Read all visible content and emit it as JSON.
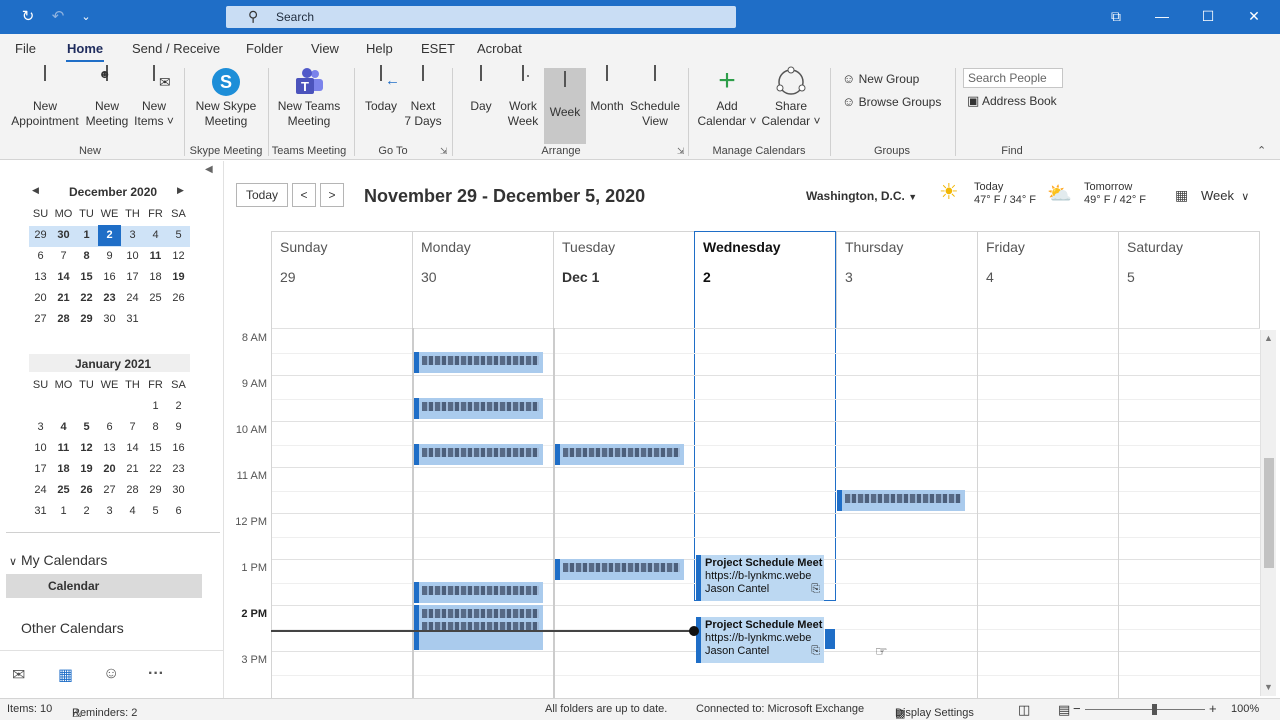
{
  "titlebar": {
    "search_placeholder": "Search",
    "refresh_icon": "↻",
    "undo_icon": "↶",
    "customize_icon": "⌄",
    "ribbon_display_icon": "⧉",
    "minimize_icon": "—",
    "maximize_icon": "☐",
    "close_icon": "✕"
  },
  "menu": {
    "tabs": [
      "File",
      "Home",
      "Send / Receive",
      "Folder",
      "View",
      "Help",
      "ESET",
      "Acrobat"
    ],
    "active": "Home"
  },
  "ribbon": {
    "new_appointment": [
      "New",
      "Appointment"
    ],
    "new_meeting": [
      "New",
      "Meeting"
    ],
    "new_items": [
      "New",
      "Items ˅"
    ],
    "group_new": "New",
    "new_skype_meeting": [
      "New Skype",
      "Meeting"
    ],
    "group_skype": "Skype Meeting",
    "new_teams_meeting": [
      "New Teams",
      "Meeting"
    ],
    "group_teams": "Teams Meeting",
    "today": [
      "Today",
      ""
    ],
    "next7": [
      "Next",
      "7 Days"
    ],
    "group_goto": "Go To",
    "day": "Day",
    "work_week": [
      "Work",
      "Week"
    ],
    "week": "Week",
    "month": "Month",
    "schedule_view": [
      "Schedule",
      "View"
    ],
    "group_arrange": "Arrange",
    "add_calendar": [
      "Add",
      "Calendar ˅"
    ],
    "share_calendar": [
      "Share",
      "Calendar ˅"
    ],
    "group_manage": "Manage Calendars",
    "new_group": "New Group",
    "browse_groups": "Browse Groups",
    "group_groups": "Groups",
    "search_people_placeholder": "Search People",
    "address_book": "Address Book",
    "group_find": "Find"
  },
  "minical": {
    "dec_title": "December 2020",
    "jan_title": "January 2021",
    "weekdays": [
      "SU",
      "MO",
      "TU",
      "WE",
      "TH",
      "FR",
      "SA"
    ],
    "dec_rows": [
      [
        "29",
        "30",
        "1",
        "2",
        "3",
        "4",
        "5"
      ],
      [
        "6",
        "7",
        "8",
        "9",
        "10",
        "11",
        "12"
      ],
      [
        "13",
        "14",
        "15",
        "16",
        "17",
        "18",
        "19"
      ],
      [
        "20",
        "21",
        "22",
        "23",
        "24",
        "25",
        "26"
      ],
      [
        "27",
        "28",
        "29",
        "30",
        "31",
        "",
        ""
      ]
    ],
    "jan_rows": [
      [
        "",
        "",
        "",
        "",
        "",
        "1",
        "2"
      ],
      [
        "3",
        "4",
        "5",
        "6",
        "7",
        "8",
        "9"
      ],
      [
        "10",
        "11",
        "12",
        "13",
        "14",
        "15",
        "16"
      ],
      [
        "17",
        "18",
        "19",
        "20",
        "21",
        "22",
        "23"
      ],
      [
        "24",
        "25",
        "26",
        "27",
        "28",
        "29",
        "30"
      ],
      [
        "31",
        "1",
        "2",
        "3",
        "4",
        "5",
        "6"
      ]
    ]
  },
  "nav": {
    "my_calendars": "My Calendars",
    "calendar": "Calendar",
    "other_calendars": "Other Calendars",
    "mail_icon": "✉",
    "calendar_icon": "▦",
    "people_icon": "☺",
    "more_icon": "···"
  },
  "header": {
    "today_button": "Today",
    "prev": "<",
    "next": ">",
    "range": "November 29 - December 5, 2020",
    "location": "Washington, D.C.",
    "today_label": "Today",
    "today_temp": "47° F / 34° F",
    "tomorrow_label": "Tomorrow",
    "tomorrow_temp": "49° F / 42° F",
    "view_label": "Week"
  },
  "days": [
    {
      "name": "Sunday",
      "num": "29"
    },
    {
      "name": "Monday",
      "num": "30"
    },
    {
      "name": "Tuesday",
      "num": "Dec 1"
    },
    {
      "name": "Wednesday",
      "num": "2"
    },
    {
      "name": "Thursday",
      "num": "3"
    },
    {
      "name": "Friday",
      "num": "4"
    },
    {
      "name": "Saturday",
      "num": "5"
    }
  ],
  "hours": [
    "8 AM",
    "9 AM",
    "10 AM",
    "11 AM",
    "12 PM",
    "1 PM",
    "2 PM",
    "3 PM"
  ],
  "events": {
    "e1_title": "Project Schedule Meet",
    "e1_link": "https://b-lynkmc.webe",
    "e1_owner": "Jason Cantel",
    "e2_title": "Project Schedule Meet",
    "e2_link": "https://b-lynkmc.webe",
    "e2_owner": "Jason Cantel",
    "attach_icon": "⎘"
  },
  "status": {
    "items": "Items: 10",
    "reminders": "Reminders: 2",
    "folders": "All folders are up to date.",
    "connected": "Connected to: Microsoft Exchange",
    "display_settings": "Display Settings",
    "zoom": "100%",
    "zoom_minus": "−",
    "zoom_plus": "+"
  },
  "colors": {
    "accent": "#1f6ec7",
    "event_fill": "#bcd8f2"
  }
}
